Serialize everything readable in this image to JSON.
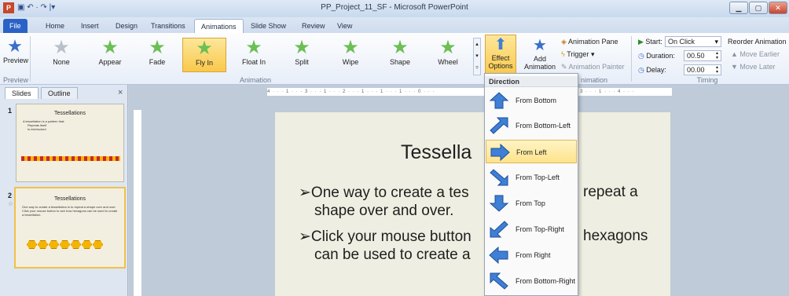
{
  "window": {
    "title": "PP_Project_11_SF - Microsoft PowerPoint"
  },
  "tabs": [
    "File",
    "Home",
    "Insert",
    "Design",
    "Transitions",
    "Animations",
    "Slide Show",
    "Review",
    "View"
  ],
  "ribbon": {
    "preview_label": "Preview",
    "preview_group": "Preview",
    "animation_group": "Animation",
    "gallery": [
      {
        "label": "None",
        "icon": "star-icon"
      },
      {
        "label": "Appear",
        "icon": "star-icon"
      },
      {
        "label": "Fade",
        "icon": "star-icon"
      },
      {
        "label": "Fly In",
        "icon": "star-icon",
        "selected": true
      },
      {
        "label": "Float In",
        "icon": "star-icon"
      },
      {
        "label": "Split",
        "icon": "star-icon"
      },
      {
        "label": "Wipe",
        "icon": "star-icon"
      },
      {
        "label": "Shape",
        "icon": "star-icon"
      },
      {
        "label": "Wheel",
        "icon": "star-icon"
      }
    ],
    "effect_options": "Effect Options",
    "effect_line1": "Effect",
    "effect_line2": "Options",
    "add_animation_1": "Add",
    "add_animation_2": "Animation",
    "animation_pane": "Animation Pane",
    "trigger": "Trigger",
    "animation_painter": "Animation Painter",
    "advanced_group": "nimation",
    "start_label": "Start:",
    "start_value": "On Click",
    "duration_label": "Duration:",
    "duration_value": "00.50",
    "delay_label": "Delay:",
    "delay_value": "00.00",
    "timing_group": "Timing",
    "reorder_label": "Reorder Animation",
    "move_earlier": "Move Earlier",
    "move_later": "Move Later"
  },
  "left_pane": {
    "tab_slides": "Slides",
    "tab_outline": "Outline",
    "close": "×",
    "slide1": {
      "num": "1",
      "title": "Tessellations",
      "bullets": [
        "A tessellation is a pattern that:",
        "Repeats itself",
        "Is interlocked"
      ]
    },
    "slide2": {
      "num": "2",
      "title": "Tessellations",
      "bullets": [
        "One way to create a tessellation is to repeat a shape over and over.",
        "Click your mouse button to see how hexagons can be used to create a tessellation."
      ]
    }
  },
  "ruler": "4 · · · 1 · · · 3 · · · 1 · · · 2 · · · 1 · · · 1 · · · 1 · · · 0 · · ·",
  "ruler_right": "3 · · · 1 · · · 4 · · ·",
  "slide": {
    "title": "Tessella",
    "bullet1_a": "One way to create a tes",
    "bullet1_b": "repeat a",
    "bullet1_c": "shape over and over.",
    "bullet2_a": "Click your mouse button",
    "bullet2_b": "hexagons",
    "bullet2_c": "can be used to create a"
  },
  "dropdown": {
    "heading": "Direction",
    "items": [
      {
        "label": "From Bottom",
        "dir": "up"
      },
      {
        "label": "From Bottom-Left",
        "dir": "up-right"
      },
      {
        "label": "From Left",
        "dir": "right",
        "highlighted": true
      },
      {
        "label": "From Top-Left",
        "dir": "down-right"
      },
      {
        "label": "From Top",
        "dir": "down"
      },
      {
        "label": "From Top-Right",
        "dir": "down-left"
      },
      {
        "label": "From Right",
        "dir": "left"
      },
      {
        "label": "From Bottom-Right",
        "dir": "up-left"
      }
    ]
  },
  "colors": {
    "accent": "#2a62c6",
    "highlight": "#fde38a",
    "arrow": "#3f7fd6"
  }
}
